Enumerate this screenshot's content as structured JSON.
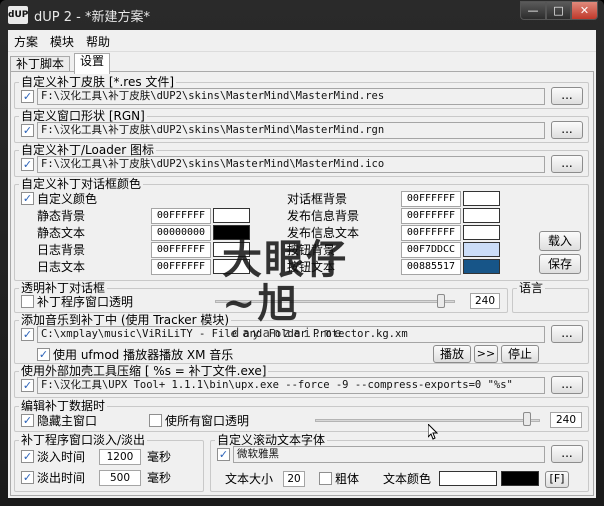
{
  "window": {
    "title": "dUP 2 - *新建方案*",
    "app_icon_text": "dUP",
    "minimize": "—",
    "maximize": "□",
    "close": "✕"
  },
  "menu": [
    "方案",
    "模块",
    "帮助"
  ],
  "tabs": [
    "补丁脚本",
    "设置"
  ],
  "skin": {
    "title": "自定义补丁皮肤 [*.res 文件]",
    "path": "F:\\汉化工具\\补丁皮肤\\dUP2\\skins\\MasterMind\\MasterMind.res",
    "browse": "..."
  },
  "shape": {
    "title": "自定义窗口形状 [RGN]",
    "path": "F:\\汉化工具\\补丁皮肤\\dUP2\\skins\\MasterMind\\MasterMind.rgn",
    "browse": "..."
  },
  "icon": {
    "title": "自定义补丁/Loader 图标",
    "path": "F:\\汉化工具\\补丁皮肤\\dUP2\\skins\\MasterMind\\MasterMind.ico",
    "browse": "..."
  },
  "colors": {
    "title": "自定义补丁对话框颜色",
    "custom_label": "自定义颜色",
    "left": [
      {
        "label": "静态背景",
        "hex": "00FFFFFF",
        "color": "#ffffff"
      },
      {
        "label": "静态文本",
        "hex": "00000000",
        "color": "#000000"
      },
      {
        "label": "日志背景",
        "hex": "00FFFFFF",
        "color": "#ffffff"
      },
      {
        "label": "日志文本",
        "hex": "00FFFFFF",
        "color": "#ffffff"
      }
    ],
    "right": [
      {
        "label": "对话框背景",
        "hex": "00FFFFFF",
        "color": "#ffffff"
      },
      {
        "label": "发布信息背景",
        "hex": "00FFFFFF",
        "color": "#ffffff"
      },
      {
        "label": "发布信息文本",
        "hex": "00FFFFFF",
        "color": "#ffffff"
      },
      {
        "label": "按钮背景",
        "hex": "00F7DDCC",
        "color": "#ccddf7"
      },
      {
        "label": "按钮文本",
        "hex": "00885517",
        "color": "#175588"
      }
    ],
    "load_button": "载入",
    "save_button": "保存"
  },
  "transparency": {
    "title": "透明补丁对话框",
    "label": "补丁程序窗口透明",
    "value": "240",
    "level": 0.94
  },
  "language": {
    "title": "语言"
  },
  "music": {
    "title": "添加音乐到补丁中 (使用 Tracker 模块)",
    "path": "C:\\xmplay\\music\\ViRiLiTY - File and Folder Protector.kg.xm",
    "browse": "...",
    "ufmod_label": "使用 ufmod 播放器播放 XM 音乐",
    "play_button": "播放",
    "next_button": ">>",
    "stop_button": "停止"
  },
  "packer": {
    "title": "使用外部加壳工具压缩 [ %s = 补丁文件.exe]",
    "command": "F:\\汉化工具\\UPX Tool+ 1.1.1\\bin\\upx.exe --force -9 --compress-exports=0 \"%s\"",
    "browse": "..."
  },
  "edit": {
    "title": "编辑补丁数据时",
    "hide_main": "隐藏主窗口",
    "all_transparent": "使所有窗口透明",
    "value": "240",
    "level": 0.94
  },
  "fade": {
    "title": "补丁程序窗口淡入/淡出",
    "in_label": "淡入时间",
    "in_value": "1200",
    "out_label": "淡出时间",
    "out_value": "500",
    "unit": "毫秒"
  },
  "font": {
    "title": "自定义滚动文本字体",
    "font_name": "微软雅黑",
    "browse": "...",
    "size_label": "文本大小",
    "size_value": "20",
    "bold_label": "粗体",
    "color_label": "文本颜色",
    "f_button": "[F]"
  },
  "watermark": {
    "main": "大眼仔~旭",
    "sub": "dayanzai.me"
  }
}
